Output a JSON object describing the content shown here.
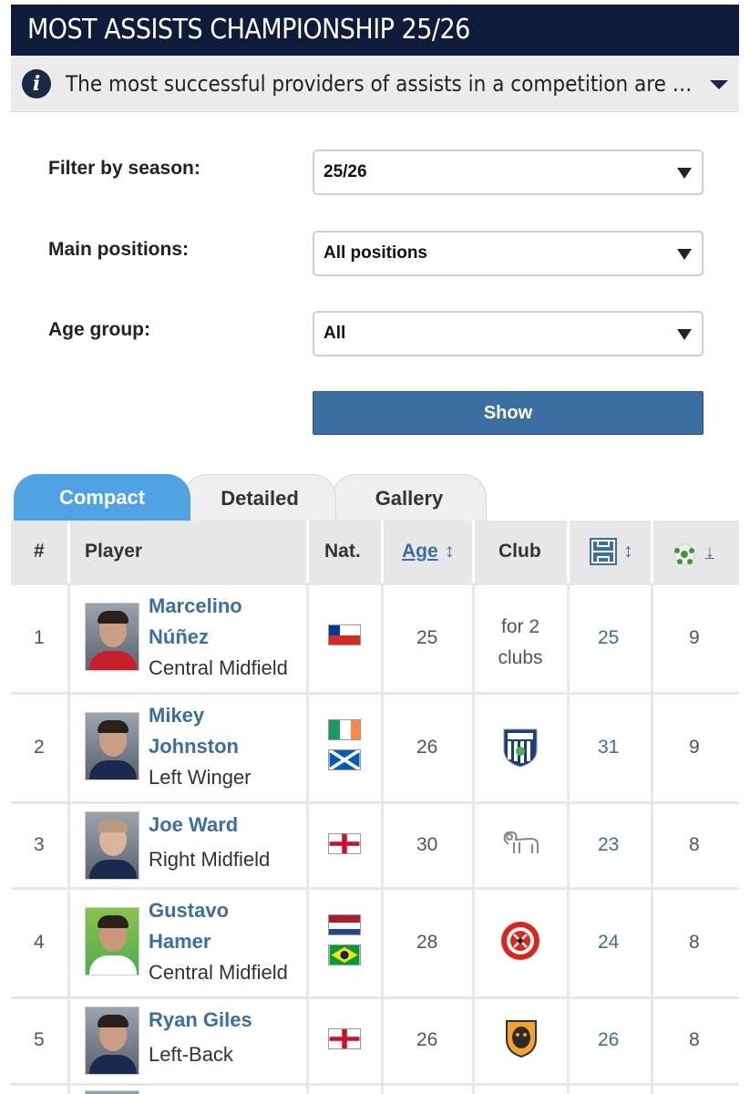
{
  "header": {
    "title": "MOST ASSISTS CHAMPIONSHIP 25/26",
    "info_text": "The most successful providers of assists in a competition are listed in thi..."
  },
  "filters": {
    "season_label": "Filter by season:",
    "season_value": "25/26",
    "positions_label": "Main positions:",
    "positions_value": "All positions",
    "age_label": "Age group:",
    "age_value": "All",
    "show_label": "Show"
  },
  "tabs": [
    {
      "label": "Compact",
      "active": true
    },
    {
      "label": "Detailed",
      "active": false
    },
    {
      "label": "Gallery",
      "active": false
    }
  ],
  "table": {
    "headers": {
      "rank": "#",
      "player": "Player",
      "nat": "Nat.",
      "age": "Age",
      "club": "Club",
      "apps_icon": "pitch-icon",
      "assists_icon": "ball-icon"
    },
    "rows": [
      {
        "rank": "1",
        "name_line1": "Marcelino",
        "name_line2": "Núñez",
        "position": "Central Midfield",
        "nations": [
          "Chile"
        ],
        "age": "25",
        "club": "for 2 clubs",
        "apps": "25",
        "assists": "9"
      },
      {
        "rank": "2",
        "name_line1": "Mikey",
        "name_line2": "Johnston",
        "position": "Left Winger",
        "nations": [
          "Ireland",
          "Scotland"
        ],
        "age": "26",
        "club": "West Bromwich Albion",
        "apps": "31",
        "assists": "9"
      },
      {
        "rank": "3",
        "name_line1": "Joe Ward",
        "name_line2": "",
        "position": "Right Midfield",
        "nations": [
          "England"
        ],
        "age": "30",
        "club": "Derby County",
        "apps": "23",
        "assists": "8"
      },
      {
        "rank": "4",
        "name_line1": "Gustavo",
        "name_line2": "Hamer",
        "position": "Central Midfield",
        "nations": [
          "Netherlands",
          "Brazil"
        ],
        "age": "28",
        "club": "Sheffield United",
        "apps": "24",
        "assists": "8"
      },
      {
        "rank": "5",
        "name_line1": "Ryan Giles",
        "name_line2": "",
        "position": "Left-Back",
        "nations": [
          "England"
        ],
        "age": "26",
        "club": "Hull City",
        "apps": "26",
        "assists": "8"
      }
    ]
  },
  "colors": {
    "title_bg": "#0e1b3a",
    "accent_blue": "#3c6fa1",
    "tab_active": "#4fa3e3"
  }
}
